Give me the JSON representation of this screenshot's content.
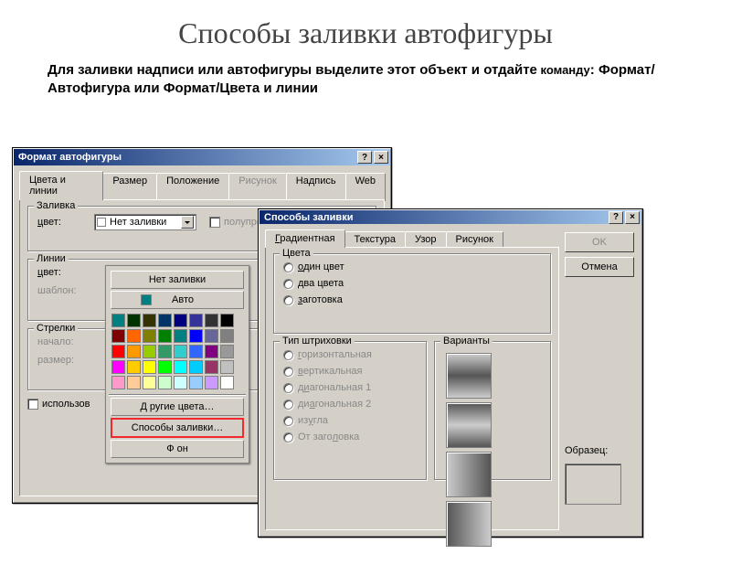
{
  "slide": {
    "title": "Способы заливки автофигуры",
    "desc_parts": [
      "Для заливки надписи или автофигуры выделите  этот объект и отдайте",
      " команду",
      ": Формат/Автофигура или Формат/Цвета и линии"
    ]
  },
  "dialog1": {
    "title": "Формат автофигуры",
    "help": "?",
    "close": "×",
    "tabs": [
      "Цвета и линии",
      "Размер",
      "Положение",
      "Рисунок",
      "Надпись",
      "Web"
    ],
    "fill": {
      "legend": "Заливка",
      "color_label": "цвет:",
      "color_value": "Нет заливки",
      "semitrans": "полупрозрачный"
    },
    "lines": {
      "legend": "Линии",
      "color_label": "цвет:",
      "template_label": "шаблон:"
    },
    "arrows": {
      "legend": "Стрелки",
      "start_label": "начало:",
      "size_label": "размер:"
    },
    "use_default": "использов"
  },
  "picker": {
    "no_fill": "Нет заливки",
    "auto": "Авто",
    "more_colors": "Другие цвета…",
    "fill_effects": "Способы заливки…",
    "background": "Фон",
    "rows": [
      [
        "#008080",
        "#003300",
        "#333300",
        "#003366",
        "#000080",
        "#333399",
        "#333333",
        "#000000"
      ],
      [
        "#800000",
        "#ff6600",
        "#808000",
        "#008000",
        "#008080",
        "#0000ff",
        "#666699",
        "#808080"
      ],
      [
        "#ff0000",
        "#ff9900",
        "#99cc00",
        "#339966",
        "#33cccc",
        "#3366ff",
        "#800080",
        "#999999"
      ],
      [
        "#ff00ff",
        "#ffcc00",
        "#ffff00",
        "#00ff00",
        "#00ffff",
        "#00ccff",
        "#993366",
        "#c0c0c0"
      ],
      [
        "#ff99cc",
        "#ffcc99",
        "#ffff99",
        "#ccffcc",
        "#ccffff",
        "#99ccff",
        "#cc99ff",
        "#ffffff"
      ]
    ]
  },
  "dialog2": {
    "title": "Способы заливки",
    "help": "?",
    "close": "×",
    "tabs": [
      "Градиентная",
      "Текстура",
      "Узор",
      "Рисунок"
    ],
    "colors": {
      "legend": "Цвета",
      "opts": [
        "один цвет",
        "два цвета",
        "заготовка"
      ]
    },
    "shading": {
      "legend": "Тип штриховки",
      "opts": [
        "горизонтальная",
        "вертикальная",
        "диагональная 1",
        "диагональная 2",
        "из угла",
        "От заголовка"
      ]
    },
    "variants": {
      "legend": "Варианты"
    },
    "sample": "Образец:",
    "ok": "OK",
    "cancel": "Отмена"
  }
}
